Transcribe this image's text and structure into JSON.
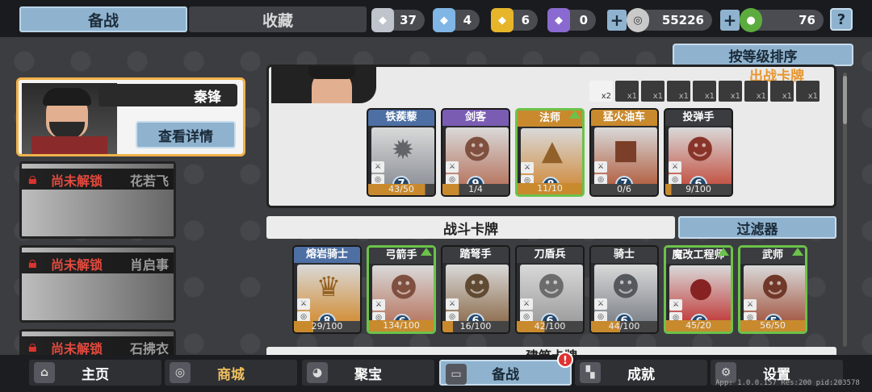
{
  "tabs": {
    "prep": "备战",
    "fav": "收藏"
  },
  "resources": [
    {
      "icon": "silver-card-icon",
      "value": "37",
      "color": "#bfc4cc"
    },
    {
      "icon": "blue-card-icon",
      "value": "4",
      "color": "#7fb6e6"
    },
    {
      "icon": "gold-card-icon",
      "value": "6",
      "color": "#e6b52a"
    },
    {
      "icon": "purple-card-icon",
      "value": "0",
      "color": "#8a6ad0"
    }
  ],
  "coins": "55226",
  "gems": "76",
  "help": "?",
  "sort_label": "按等级排序",
  "hero": {
    "name": "秦锋",
    "detail": "查看详情"
  },
  "locked_heroes": [
    {
      "label": "尚未解锁",
      "name": "花若飞"
    },
    {
      "label": "尚未解锁",
      "name": "肖启事"
    },
    {
      "label": "尚未解锁",
      "name": "石拂衣"
    }
  ],
  "deck_title": "出战卡牌",
  "slots": [
    "x2",
    "x1",
    "x1",
    "x1",
    "x1",
    "x1",
    "x1",
    "x1",
    "x1"
  ],
  "deck_cards": [
    {
      "name": "铁蒺藜",
      "level": "7",
      "count": "43/50",
      "progress": 0.86,
      "up": false,
      "head": "#4d6fa3",
      "sym": "✹",
      "art": "#8a8f96"
    },
    {
      "name": "剑客",
      "level": "9",
      "count": "1/4",
      "progress": 0.25,
      "up": false,
      "head": "#7a5cb3",
      "sym": "☻",
      "art": "#b5715a"
    },
    {
      "name": "法师",
      "level": "8",
      "count": "11/10",
      "progress": 1.0,
      "up": true,
      "head": "#c98a2e",
      "sym": "▲",
      "art": "#d08a3a"
    },
    {
      "name": "猛火油车",
      "level": "7",
      "count": "0/6",
      "progress": 0.0,
      "up": false,
      "head": "#c98a2e",
      "sym": "■",
      "art": "#b05a3a"
    },
    {
      "name": "投弹手",
      "level": "6",
      "count": "9/100",
      "progress": 0.09,
      "up": false,
      "head": "#3a3c40",
      "sym": "☻",
      "art": "#c24a3a"
    }
  ],
  "battle_title": "战斗卡牌",
  "filter_label": "过滤器",
  "battle_cards": [
    {
      "name": "熔岩骑士",
      "level": "8",
      "count": "29/100",
      "progress": 0.29,
      "up": false,
      "head": "#4d6fa3",
      "sym": "♛",
      "art": "#d28a2e"
    },
    {
      "name": "弓箭手",
      "level": "6",
      "count": "134/100",
      "progress": 1.0,
      "up": true,
      "head": "#3a3c40",
      "sym": "☻",
      "art": "#b5715a"
    },
    {
      "name": "踏弩手",
      "level": "6",
      "count": "16/100",
      "progress": 0.16,
      "up": false,
      "head": "#3a3c40",
      "sym": "☻",
      "art": "#8b6a4a"
    },
    {
      "name": "刀盾兵",
      "level": "6",
      "count": "42/100",
      "progress": 0.42,
      "up": false,
      "head": "#3a3c40",
      "sym": "☻",
      "art": "#9a9a9a"
    },
    {
      "name": "骑士",
      "level": "6",
      "count": "44/100",
      "progress": 0.44,
      "up": false,
      "head": "#3a3c40",
      "sym": "☻",
      "art": "#7a7f86"
    },
    {
      "name": "魔改工程师",
      "level": "6",
      "count": "45/20",
      "progress": 1.0,
      "up": true,
      "head": "#3a3c40",
      "sym": "●",
      "art": "#c03030"
    },
    {
      "name": "武师",
      "level": "5",
      "count": "56/50",
      "progress": 1.0,
      "up": true,
      "head": "#3a3c40",
      "sym": "☻",
      "art": "#a0503a"
    }
  ],
  "build_title": "建筑卡牌",
  "nav": [
    {
      "label": "主页",
      "icon": "home-icon",
      "glyph": "⌂"
    },
    {
      "label": "商城",
      "icon": "coins-icon",
      "glyph": "◎"
    },
    {
      "label": "聚宝",
      "icon": "treasure-bowl-icon",
      "glyph": "◕"
    },
    {
      "label": "备战",
      "icon": "cards-icon",
      "glyph": "▭"
    },
    {
      "label": "成就",
      "icon": "achievements-icon",
      "glyph": "▚"
    },
    {
      "label": "设置",
      "icon": "gear-icon",
      "glyph": "⚙"
    }
  ],
  "nav_badge": "!",
  "version": "App: 1.0.0.157 Res:200 pid:203578"
}
